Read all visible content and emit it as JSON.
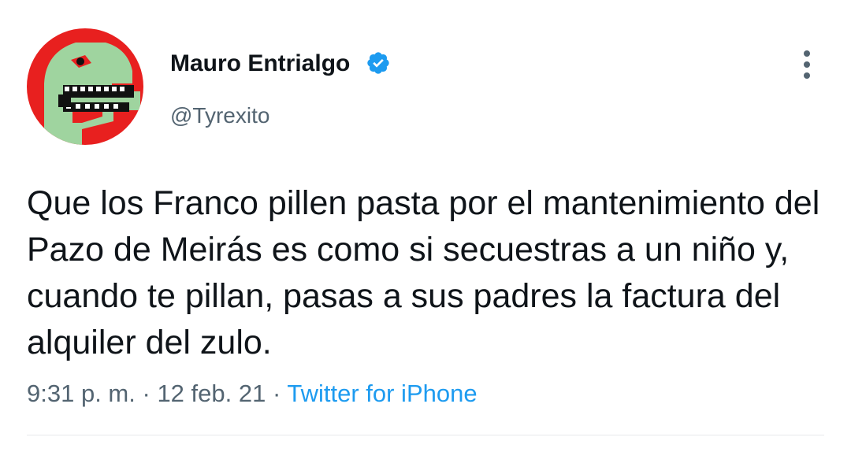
{
  "tweet": {
    "display_name": "Mauro Entrialgo",
    "handle": "@Tyrexito",
    "verified": true,
    "text": "Que los Franco pillen pasta por el mantenimiento del Pazo de Meirás es como si secuestras a un niño y, cuando te pillan, pasas a sus padres la factura del alquiler del zulo.",
    "time": "9:31 p. m.",
    "separator": "·",
    "date": "12 feb. 21",
    "source": "Twitter for iPhone"
  },
  "icons": {
    "verified": "verified-badge-icon",
    "more": "more-options-icon",
    "avatar": "dinosaur-avatar"
  },
  "colors": {
    "verified_blue": "#1d9bf0",
    "secondary_text": "#536471",
    "link": "#1d9bf0",
    "avatar_red": "#e8201f",
    "avatar_green": "#9fd49f"
  }
}
